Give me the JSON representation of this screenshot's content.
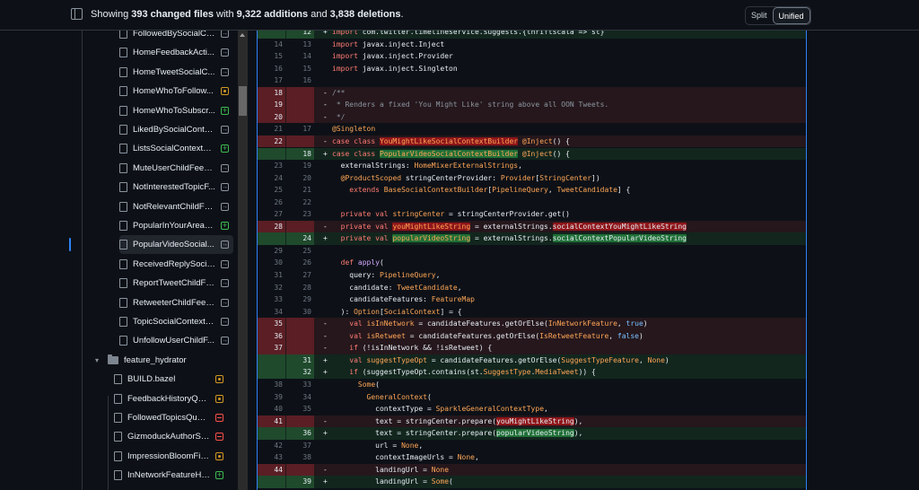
{
  "header": {
    "prefix": "Showing ",
    "changed_files": "393 changed files",
    "middle": " with ",
    "additions": "9,322 additions",
    "and": " and ",
    "deletions": "3,838 deletions",
    "suffix": ".",
    "split_label": "Split",
    "unified_label": "Unified",
    "active_view": "Unified"
  },
  "colors": {
    "accent": "#2f81f7",
    "added": "#3fb950",
    "deleted": "#f85149",
    "modified": "#d29922"
  },
  "file_tree": [
    {
      "name": "FollowedBySocialCo...",
      "status": "renamed",
      "selected": false
    },
    {
      "name": "HomeFeedbackActi...",
      "status": "renamed",
      "selected": false
    },
    {
      "name": "HomeTweetSocialC...",
      "status": "renamed",
      "selected": false
    },
    {
      "name": "HomeWhoToFollow...",
      "status": "modified",
      "selected": false
    },
    {
      "name": "HomeWhoToSubscr...",
      "status": "added",
      "selected": false
    },
    {
      "name": "LikedBySocialConte...",
      "status": "renamed",
      "selected": false
    },
    {
      "name": "ListsSocialContextB...",
      "status": "added",
      "selected": false
    },
    {
      "name": "MuteUserChildFeed...",
      "status": "renamed",
      "selected": false
    },
    {
      "name": "NotInterestedTopicF...",
      "status": "renamed",
      "selected": false
    },
    {
      "name": "NotRelevantChildFe...",
      "status": "renamed",
      "selected": false
    },
    {
      "name": "PopularInYourAreaS...",
      "status": "added",
      "selected": false
    },
    {
      "name": "PopularVideoSocial...",
      "status": "renamed",
      "selected": true
    },
    {
      "name": "ReceivedReplySocial...",
      "status": "renamed",
      "selected": false
    },
    {
      "name": "ReportTweetChildFe...",
      "status": "renamed",
      "selected": false
    },
    {
      "name": "RetweeterChildFeed...",
      "status": "renamed",
      "selected": false
    },
    {
      "name": "TopicSocialContextB...",
      "status": "renamed",
      "selected": false
    },
    {
      "name": "UnfollowUserChildF...",
      "status": "renamed",
      "selected": false
    }
  ],
  "folder": {
    "name": "feature_hydrator"
  },
  "folder_files": [
    {
      "name": "BUILD.bazel",
      "status": "modified"
    },
    {
      "name": "FeedbackHistoryQue...",
      "status": "modified"
    },
    {
      "name": "FollowedTopicsQuery...",
      "status": "deleted"
    },
    {
      "name": "GizmoduckAuthorSaf...",
      "status": "deleted"
    },
    {
      "name": "ImpressionBloomFilt...",
      "status": "modified"
    },
    {
      "name": "InNetworkFeatureHy...",
      "status": "added"
    }
  ],
  "diff_lines": [
    {
      "type": "add",
      "old": "",
      "new": "12",
      "marker": "+",
      "tokens": [
        [
          "kw",
          "import"
        ],
        [
          "pl",
          " com.twitter.timelineservice.suggests.{thriftscala => st}"
        ]
      ]
    },
    {
      "type": "ctx",
      "old": "14",
      "new": "13",
      "marker": "",
      "tokens": [
        [
          "kw",
          "import"
        ],
        [
          "pl",
          " javax.inject.Inject"
        ]
      ]
    },
    {
      "type": "ctx",
      "old": "15",
      "new": "14",
      "marker": "",
      "tokens": [
        [
          "kw",
          "import"
        ],
        [
          "pl",
          " javax.inject.Provider"
        ]
      ]
    },
    {
      "type": "ctx",
      "old": "16",
      "new": "15",
      "marker": "",
      "tokens": [
        [
          "kw",
          "import"
        ],
        [
          "pl",
          " javax.inject.Singleton"
        ]
      ]
    },
    {
      "type": "ctx",
      "old": "17",
      "new": "16",
      "marker": "",
      "tokens": []
    },
    {
      "type": "del",
      "old": "18",
      "new": "",
      "marker": "-",
      "tokens": [
        [
          "cm",
          "/**"
        ]
      ]
    },
    {
      "type": "del",
      "old": "19",
      "new": "",
      "marker": "-",
      "tokens": [
        [
          "cm",
          " * Renders a fixed 'You Might Like' string above all OON Tweets."
        ]
      ]
    },
    {
      "type": "del",
      "old": "20",
      "new": "",
      "marker": "-",
      "tokens": [
        [
          "cm",
          " */"
        ]
      ]
    },
    {
      "type": "ctx",
      "old": "21",
      "new": "17",
      "marker": "",
      "tokens": [
        [
          "ty",
          "@Singleton"
        ]
      ]
    },
    {
      "type": "del",
      "old": "22",
      "new": "",
      "marker": "-",
      "tokens": [
        [
          "kw",
          "case class "
        ],
        [
          "ty hl-del",
          "YouMightLikeSocialContextBuilder"
        ],
        [
          "ty",
          " @Inject"
        ],
        [
          "pl",
          "() {"
        ]
      ]
    },
    {
      "type": "add",
      "old": "",
      "new": "18",
      "marker": "+",
      "tokens": [
        [
          "kw",
          "case class "
        ],
        [
          "ty hl-add",
          "PopularVideoSocialContextBuilder"
        ],
        [
          "ty",
          " @Inject"
        ],
        [
          "pl",
          "() {"
        ]
      ]
    },
    {
      "type": "ctx",
      "old": "23",
      "new": "19",
      "marker": "",
      "tokens": [
        [
          "pl",
          "  externalStrings: "
        ],
        [
          "ty",
          "HomeMixerExternalStrings"
        ],
        [
          "pl",
          ","
        ]
      ]
    },
    {
      "type": "ctx",
      "old": "24",
      "new": "20",
      "marker": "",
      "tokens": [
        [
          "pl",
          "  "
        ],
        [
          "ty",
          "@ProductScoped"
        ],
        [
          "pl",
          " stringCenterProvider: "
        ],
        [
          "ty",
          "Provider"
        ],
        [
          "pl",
          "["
        ],
        [
          "ty",
          "StringCenter"
        ],
        [
          "pl",
          "])"
        ]
      ]
    },
    {
      "type": "ctx",
      "old": "25",
      "new": "21",
      "marker": "",
      "tokens": [
        [
          "kw",
          "    extends "
        ],
        [
          "ty",
          "BaseSocialContextBuilder"
        ],
        [
          "pl",
          "["
        ],
        [
          "ty",
          "PipelineQuery"
        ],
        [
          "pl",
          ", "
        ],
        [
          "ty",
          "TweetCandidate"
        ],
        [
          "pl",
          "] {"
        ]
      ]
    },
    {
      "type": "ctx",
      "old": "26",
      "new": "22",
      "marker": "",
      "tokens": []
    },
    {
      "type": "ctx",
      "old": "27",
      "new": "23",
      "marker": "",
      "tokens": [
        [
          "kw",
          "  private val "
        ],
        [
          "ty",
          "stringCenter"
        ],
        [
          "pl",
          " = stringCenterProvider.get()"
        ]
      ]
    },
    {
      "type": "del",
      "old": "28",
      "new": "",
      "marker": "-",
      "tokens": [
        [
          "kw",
          "  private val "
        ],
        [
          "ty hl-del",
          "youMightLikeString"
        ],
        [
          "pl",
          " = externalStrings."
        ],
        [
          "pl hl-del",
          "socialContextYouMightLikeString"
        ]
      ]
    },
    {
      "type": "add",
      "old": "",
      "new": "24",
      "marker": "+",
      "tokens": [
        [
          "kw",
          "  private val "
        ],
        [
          "ty hl-add",
          "popularVideoString"
        ],
        [
          "pl",
          " = externalStrings."
        ],
        [
          "pl hl-add",
          "socialContextPopularVideoString"
        ]
      ]
    },
    {
      "type": "ctx",
      "old": "29",
      "new": "25",
      "marker": "",
      "tokens": []
    },
    {
      "type": "ctx",
      "old": "30",
      "new": "26",
      "marker": "",
      "tokens": [
        [
          "kw",
          "  def "
        ],
        [
          "fn",
          "apply"
        ],
        [
          "pl",
          "("
        ]
      ]
    },
    {
      "type": "ctx",
      "old": "31",
      "new": "27",
      "marker": "",
      "tokens": [
        [
          "pl",
          "    query: "
        ],
        [
          "ty",
          "PipelineQuery"
        ],
        [
          "pl",
          ","
        ]
      ]
    },
    {
      "type": "ctx",
      "old": "32",
      "new": "28",
      "marker": "",
      "tokens": [
        [
          "pl",
          "    candidate: "
        ],
        [
          "ty",
          "TweetCandidate"
        ],
        [
          "pl",
          ","
        ]
      ]
    },
    {
      "type": "ctx",
      "old": "33",
      "new": "29",
      "marker": "",
      "tokens": [
        [
          "pl",
          "    candidateFeatures: "
        ],
        [
          "ty",
          "FeatureMap"
        ]
      ]
    },
    {
      "type": "ctx",
      "old": "34",
      "new": "30",
      "marker": "",
      "tokens": [
        [
          "pl",
          "  ): "
        ],
        [
          "ty",
          "Option"
        ],
        [
          "pl",
          "["
        ],
        [
          "ty",
          "SocialContext"
        ],
        [
          "pl",
          "] = {"
        ]
      ]
    },
    {
      "type": "del",
      "old": "35",
      "new": "",
      "marker": "-",
      "tokens": [
        [
          "kw",
          "    val "
        ],
        [
          "ty",
          "isInNetwork"
        ],
        [
          "pl",
          " = candidateFeatures.getOrElse("
        ],
        [
          "ty",
          "InNetworkFeature"
        ],
        [
          "pl",
          ", "
        ],
        [
          "cst",
          "true"
        ],
        [
          "pl",
          ")"
        ]
      ]
    },
    {
      "type": "del",
      "old": "36",
      "new": "",
      "marker": "-",
      "tokens": [
        [
          "kw",
          "    val "
        ],
        [
          "ty",
          "isRetweet"
        ],
        [
          "pl",
          " = candidateFeatures.getOrElse("
        ],
        [
          "ty",
          "IsRetweetFeature"
        ],
        [
          "pl",
          ", "
        ],
        [
          "cst",
          "false"
        ],
        [
          "pl",
          ")"
        ]
      ]
    },
    {
      "type": "del",
      "old": "37",
      "new": "",
      "marker": "-",
      "tokens": [
        [
          "kw",
          "    if "
        ],
        [
          "pl",
          "(!isInNetwork && !isRetweet) {"
        ]
      ]
    },
    {
      "type": "add",
      "old": "",
      "new": "31",
      "marker": "+",
      "tokens": [
        [
          "kw",
          "    val "
        ],
        [
          "ty",
          "suggestTypeOpt"
        ],
        [
          "pl",
          " = candidateFeatures.getOrElse("
        ],
        [
          "ty",
          "SuggestTypeFeature"
        ],
        [
          "pl",
          ", "
        ],
        [
          "ty",
          "None"
        ],
        [
          "pl",
          ")"
        ]
      ]
    },
    {
      "type": "add",
      "old": "",
      "new": "32",
      "marker": "+",
      "tokens": [
        [
          "kw",
          "    if "
        ],
        [
          "pl",
          "(suggestTypeOpt.contains(st."
        ],
        [
          "ty",
          "SuggestType"
        ],
        [
          "pl",
          "."
        ],
        [
          "ty",
          "MediaTweet"
        ],
        [
          "pl",
          ")) {"
        ]
      ]
    },
    {
      "type": "ctx",
      "old": "38",
      "new": "33",
      "marker": "",
      "tokens": [
        [
          "pl",
          "      "
        ],
        [
          "ty",
          "Some"
        ],
        [
          "pl",
          "("
        ]
      ]
    },
    {
      "type": "ctx",
      "old": "39",
      "new": "34",
      "marker": "",
      "tokens": [
        [
          "pl",
          "        "
        ],
        [
          "ty",
          "GeneralContext"
        ],
        [
          "pl",
          "("
        ]
      ]
    },
    {
      "type": "ctx",
      "old": "40",
      "new": "35",
      "marker": "",
      "tokens": [
        [
          "pl",
          "          contextType = "
        ],
        [
          "ty",
          "SparkleGeneralContextType"
        ],
        [
          "pl",
          ","
        ]
      ]
    },
    {
      "type": "del",
      "old": "41",
      "new": "",
      "marker": "-",
      "tokens": [
        [
          "pl",
          "          text = stringCenter.prepare("
        ],
        [
          "pl hl-del",
          "youMightLikeString"
        ],
        [
          "pl",
          "),"
        ]
      ]
    },
    {
      "type": "add",
      "old": "",
      "new": "36",
      "marker": "+",
      "tokens": [
        [
          "pl",
          "          text = stringCenter.prepare("
        ],
        [
          "pl hl-add",
          "popularVideoString"
        ],
        [
          "pl",
          "),"
        ]
      ]
    },
    {
      "type": "ctx",
      "old": "42",
      "new": "37",
      "marker": "",
      "tokens": [
        [
          "pl",
          "          url = "
        ],
        [
          "ty",
          "None"
        ],
        [
          "pl",
          ","
        ]
      ]
    },
    {
      "type": "ctx",
      "old": "43",
      "new": "38",
      "marker": "",
      "tokens": [
        [
          "pl",
          "          contextImageUrls = "
        ],
        [
          "ty",
          "None"
        ],
        [
          "pl",
          ","
        ]
      ]
    },
    {
      "type": "del",
      "old": "44",
      "new": "",
      "marker": "-",
      "tokens": [
        [
          "pl",
          "          landingUrl = "
        ],
        [
          "ty",
          "None"
        ]
      ]
    },
    {
      "type": "add",
      "old": "",
      "new": "39",
      "marker": "+",
      "tokens": [
        [
          "pl",
          "          landingUrl = "
        ],
        [
          "ty",
          "Some"
        ],
        [
          "pl",
          "("
        ]
      ]
    }
  ]
}
